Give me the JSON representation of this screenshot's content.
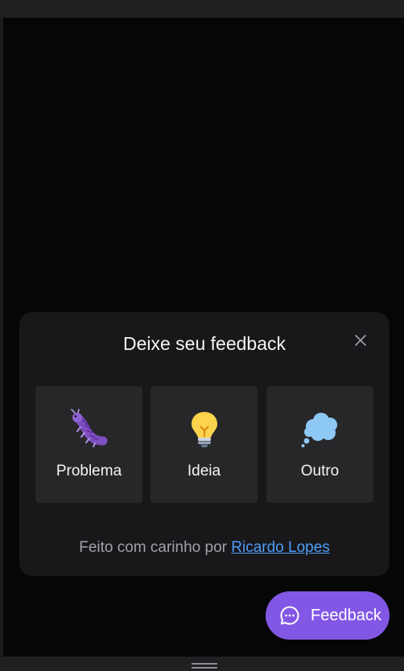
{
  "widget": {
    "title": "Deixe seu feedback",
    "close_icon": "close-icon",
    "options": [
      {
        "label": "Problema",
        "icon": "bug-icon"
      },
      {
        "label": "Ideia",
        "icon": "lightbulb-icon"
      },
      {
        "label": "Outro",
        "icon": "thought-balloon-icon"
      }
    ],
    "footer_text": "Feito com carinho por",
    "footer_link": "Ricardo Lopes"
  },
  "fab": {
    "label": "Feedback",
    "icon": "chat-bubble-icon"
  },
  "colors": {
    "accent": "#8257e5",
    "surface": "#18181b",
    "option_bg": "#27272a",
    "link": "#4f9cf9",
    "page_bg": "#060606"
  }
}
